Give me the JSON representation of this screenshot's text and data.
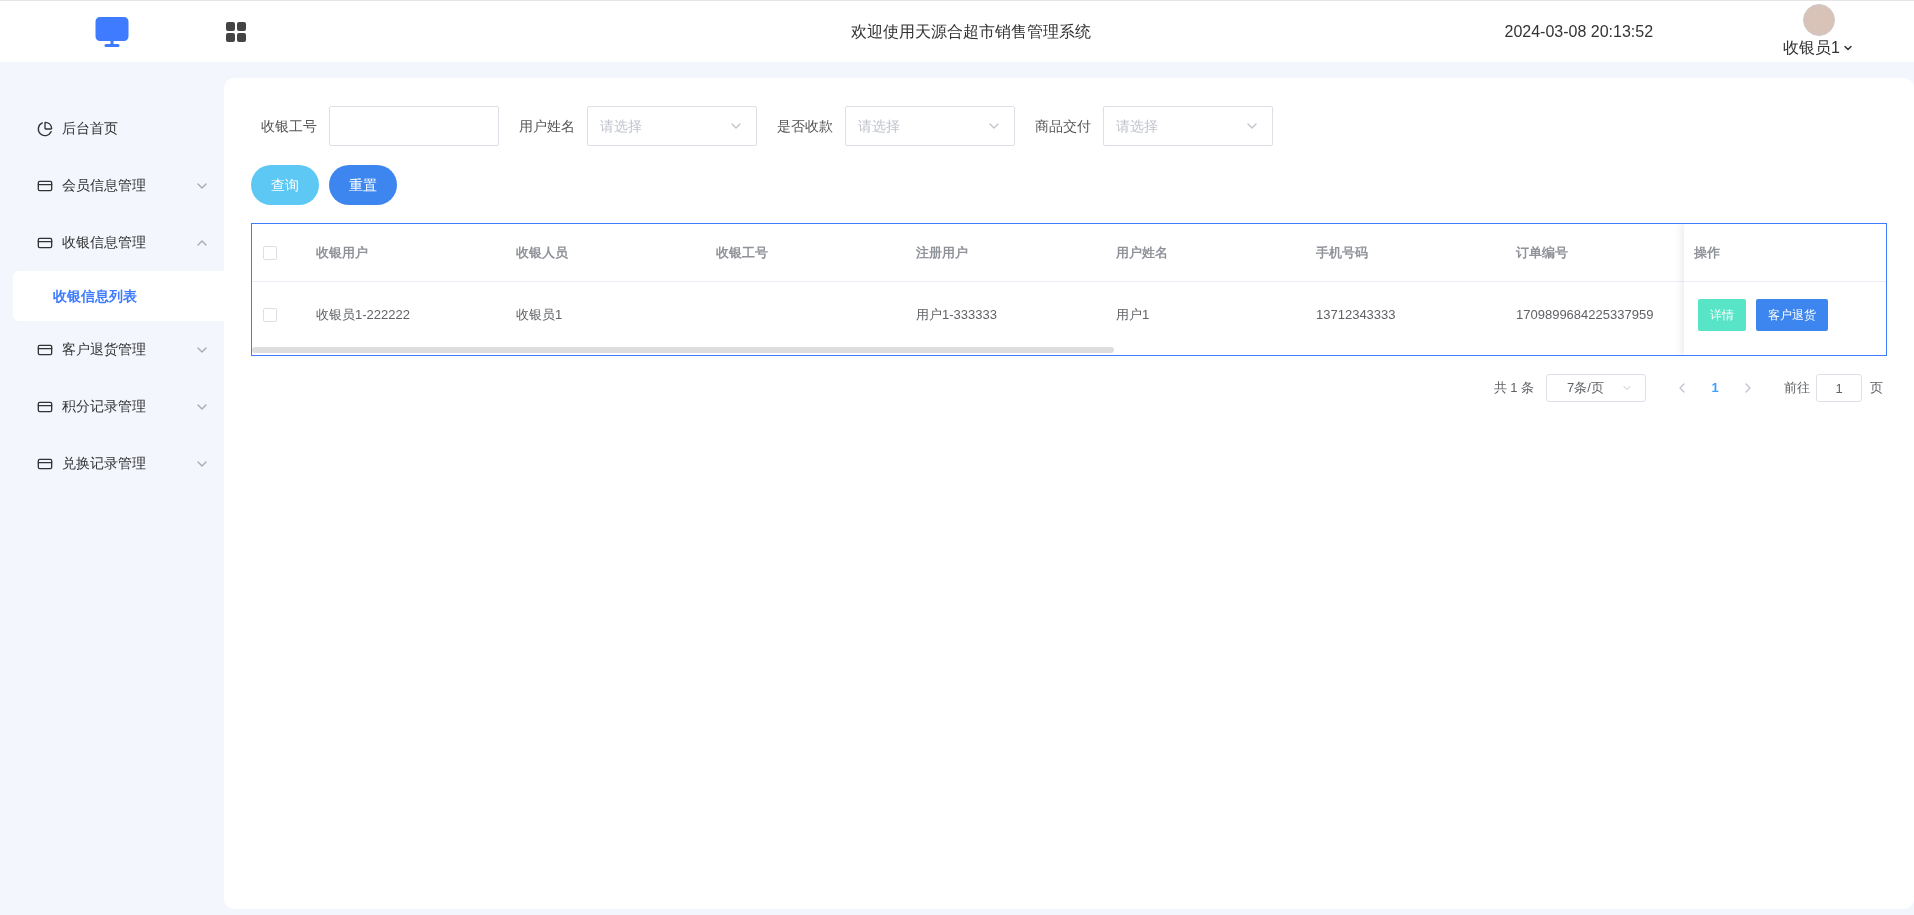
{
  "header": {
    "title": "欢迎使用天源合超市销售管理系统",
    "datetime": "2024-03-08 20:13:52",
    "user": "收银员1"
  },
  "sidebar": {
    "items": [
      {
        "label": "后台首页",
        "kind": "link"
      },
      {
        "label": "会员信息管理",
        "kind": "group",
        "expanded": false
      },
      {
        "label": "收银信息管理",
        "kind": "group",
        "expanded": true,
        "children": [
          {
            "label": "收银信息列表",
            "selected": true
          }
        ]
      },
      {
        "label": "客户退货管理",
        "kind": "group",
        "expanded": false
      },
      {
        "label": "积分记录管理",
        "kind": "group",
        "expanded": false
      },
      {
        "label": "兑换记录管理",
        "kind": "group",
        "expanded": false
      }
    ]
  },
  "filters": [
    {
      "label": "收银工号",
      "kind": "text"
    },
    {
      "label": "用户姓名",
      "kind": "select",
      "placeholder": "请选择"
    },
    {
      "label": "是否收款",
      "kind": "select",
      "placeholder": "请选择"
    },
    {
      "label": "商品交付",
      "kind": "select",
      "placeholder": "请选择"
    }
  ],
  "buttons": [
    {
      "label": "查询",
      "kind": "search"
    },
    {
      "label": "重置",
      "kind": "reset"
    }
  ],
  "table": {
    "all_selected": false,
    "columns": [
      "收银用户",
      "收银人员",
      "收银工号",
      "注册用户",
      "用户姓名",
      "手机号码",
      "订单编号"
    ],
    "actions_column": "操作",
    "rows": [
      {
        "selected": false,
        "cells": [
          "收银员1-222222",
          "收银员1",
          "",
          "用户1-333333",
          "用户1",
          "13712343333",
          "1709899684225337959"
        ],
        "actions": [
          {
            "label": "详情",
            "kind": "detail"
          },
          {
            "label": "客户退货",
            "kind": "return"
          }
        ]
      }
    ]
  },
  "pagination": {
    "total": "共 1 条",
    "page_size": "7条/页",
    "pages": [
      {
        "label": "1",
        "selected": true
      }
    ],
    "goto_label": "前往",
    "goto_value": "1",
    "goto_suffix": "页"
  }
}
